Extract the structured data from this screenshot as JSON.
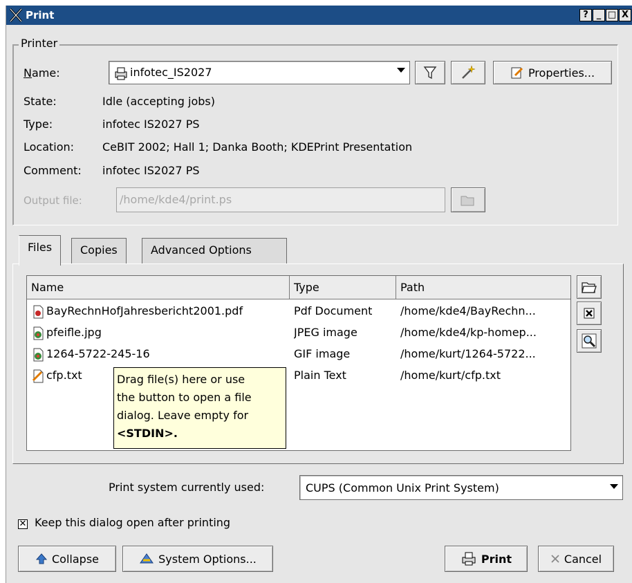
{
  "window": {
    "title": "Print"
  },
  "window_buttons": [
    "?",
    "_",
    "□",
    "X"
  ],
  "printer_group": {
    "legend": "Printer",
    "name_label": "Name:",
    "name_value": "infotec_IS2027",
    "properties_label": "Properties...",
    "state_label": "State:",
    "state_value": "Idle (accepting jobs)",
    "type_label": "Type:",
    "type_value": "infotec IS2027 PS",
    "location_label": "Location:",
    "location_value": "CeBIT 2002; Hall 1; Danka Booth; KDEPrint Presentation",
    "comment_label": "Comment:",
    "comment_value": "infotec  IS2027 PS",
    "output_label": "Output file:",
    "output_value": "/home/kde4/print.ps"
  },
  "tabs": [
    {
      "label": "Files",
      "active": true
    },
    {
      "label": "Copies",
      "active": false
    },
    {
      "label": "Advanced Options",
      "active": false
    }
  ],
  "files_table": {
    "columns": [
      "Name",
      "Type",
      "Path"
    ],
    "rows": [
      {
        "name": "BayRechnHofJahresbericht2001.pdf",
        "type": "Pdf Document",
        "path": "/home/kde4/BayRechn...",
        "icon": "pdf-icon"
      },
      {
        "name": "pfeifle.jpg",
        "type": "JPEG image",
        "path": "/home/kde4/kp-homep...",
        "icon": "image-icon"
      },
      {
        "name": "1264-5722-245-16",
        "type": "GIF image",
        "path": "/home/kurt/1264-5722...",
        "icon": "image-icon"
      },
      {
        "name": "cfp.txt",
        "type": "Plain Text",
        "path": "/home/kurt/cfp.txt",
        "icon": "text-file-icon"
      }
    ]
  },
  "tooltip": {
    "line1": "Drag file(s) here or use",
    "line2": "the button to open a file",
    "line3": "dialog. Leave empty for",
    "line4": "<STDIN>."
  },
  "print_system": {
    "label": "Print system currently used:",
    "value": "CUPS (Common Unix Print System)"
  },
  "keep_open": {
    "label": "Keep this dialog open after printing",
    "checked": true
  },
  "buttons": {
    "collapse": "Collapse",
    "system_options": "System Options...",
    "print": "Print",
    "cancel": "Cancel"
  },
  "colors": {
    "titlebar": "#1c4d86",
    "background": "#e6e6e6",
    "tooltip_bg": "#ffffdc"
  }
}
